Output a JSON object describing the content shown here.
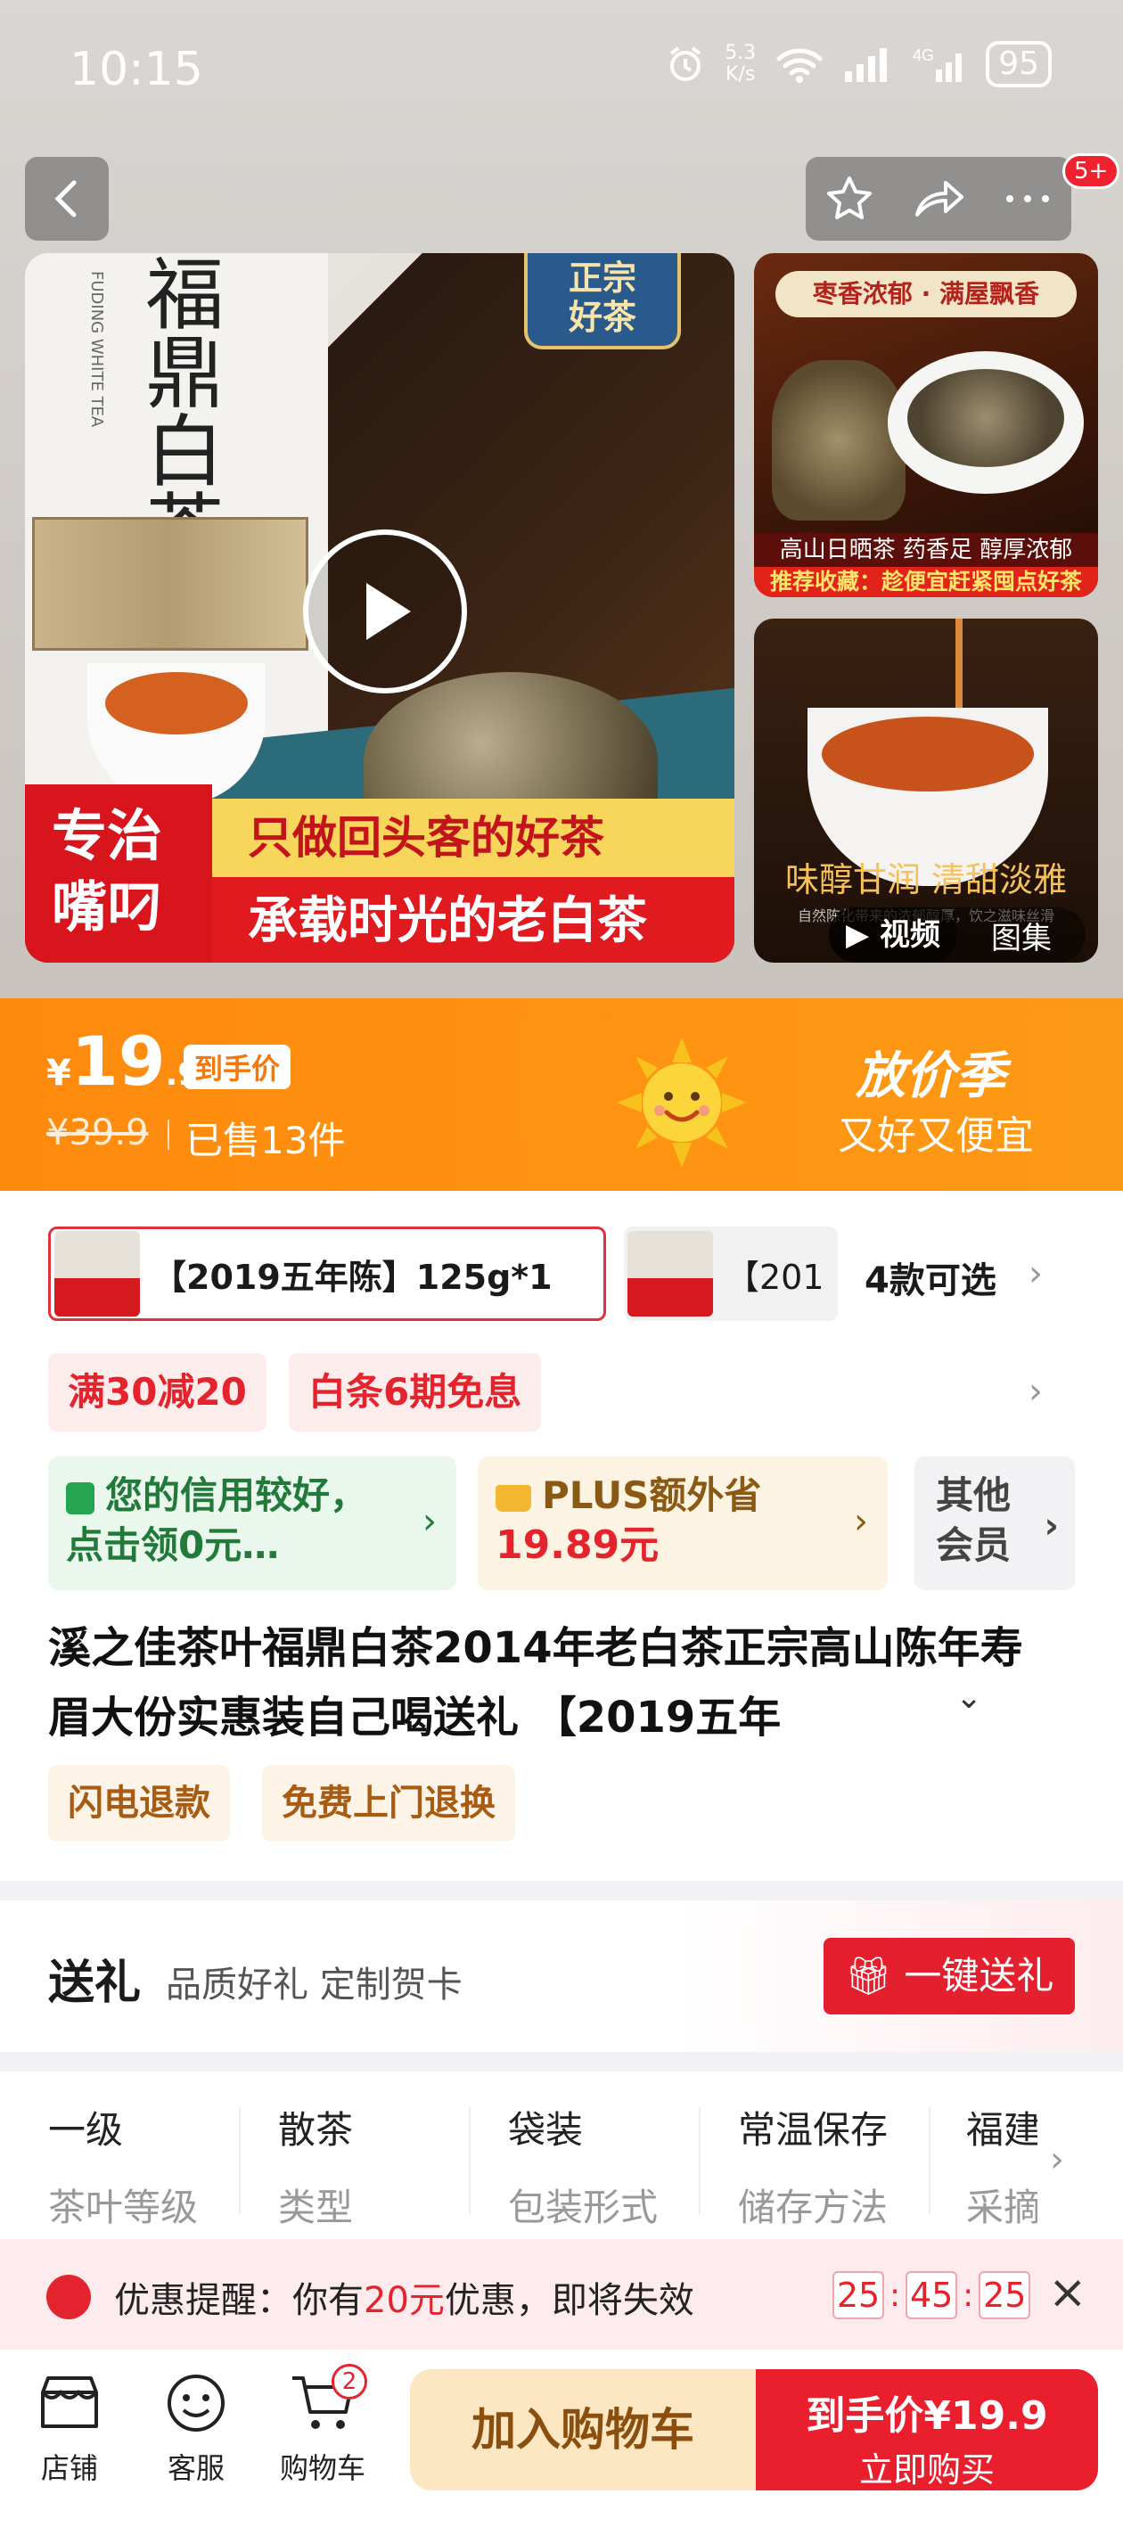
{
  "status_bar": {
    "time": "10:15",
    "speed_value": "5.3",
    "speed_unit": "K/s",
    "battery": "95"
  },
  "nav": {
    "more_badge": "5+"
  },
  "gallery": {
    "main_seal": "正宗\n好茶",
    "main_pkg_title": "福鼎白茶",
    "main_pkg_sub": "FUDING WHITE TEA",
    "main_banner_left": "专治\n嘴叼",
    "main_banner_line1": "只做回头客的好茶",
    "main_banner_line2": "承载时光的老白茶",
    "side1_top": "枣香浓郁 · 满屋飘香",
    "side1_line1": "高山日晒茶 药香足 醇厚浓郁",
    "side1_line2": "推荐收藏：趁便宜赶紧囤点好茶",
    "side2_text": "味醇甘润  清甜淡雅",
    "side2_small": "自然陈化带来的浓郁醇厚，饮之滋味丝滑",
    "tab_video": "▶ 视频",
    "tab_gallery": "图集"
  },
  "price": {
    "yen": "¥",
    "int": "19",
    "dec": ".9",
    "tag": "到手价",
    "original": "¥39.9",
    "sold": "已售13件",
    "promo_title": "放价季",
    "promo_sub": "又好又便宜"
  },
  "sku": {
    "selected": "【2019五年陈】125g*1",
    "second": "【201",
    "count": "4款可选"
  },
  "promos": [
    "满30减20",
    "白条6期免息"
  ],
  "credit": {
    "text": "您的信用较好，点击领0元…",
    "plus_title": "PLUS额外省",
    "plus_value": "19.89元",
    "member": "其他会员"
  },
  "product_title": "溪之佳茶叶福鼎白茶2014年老白茶正宗高山陈年寿眉大份实惠装自己喝送礼 【2019五年",
  "services": [
    "闪电退款",
    "免费上门退换"
  ],
  "gift": {
    "title": "送礼",
    "sub": "品质好礼 定制贺卡",
    "button": "一键送礼"
  },
  "params": [
    {
      "value": "一级",
      "key": "茶叶等级"
    },
    {
      "value": "散茶",
      "key": "类型"
    },
    {
      "value": "袋装",
      "key": "包装形式"
    },
    {
      "value": "常温保存",
      "key": "储存方法"
    },
    {
      "value": "福建",
      "key": "采摘"
    }
  ],
  "reminder": {
    "prefix": "优惠提醒：你有",
    "amount": "20元",
    "suffix": "优惠，即将失效",
    "h": "25",
    "m": "45",
    "s": "25"
  },
  "bottom": {
    "shop": "店铺",
    "service": "客服",
    "cart": "购物车",
    "cart_count": "2",
    "add_cart": "加入购物车",
    "buy_line1": "到手价¥19.9",
    "buy_line2": "立即购买"
  },
  "colors": {
    "accent_red": "#e4232d",
    "price_orange": "#fe8a0d"
  }
}
